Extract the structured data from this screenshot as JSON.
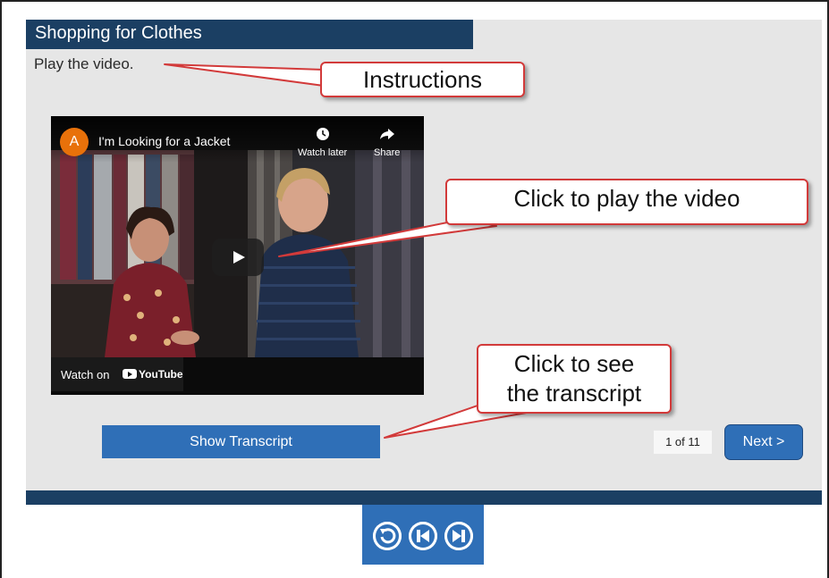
{
  "lesson": {
    "title": "Shopping for Clothes",
    "instruction": "Play the video."
  },
  "video": {
    "channel_initial": "A",
    "title": "I'm Looking for a Jacket",
    "watch_later_label": "Watch later",
    "share_label": "Share",
    "watch_on_label": "Watch on",
    "youtube_label": "YouTube"
  },
  "controls": {
    "show_transcript_label": "Show Transcript",
    "page_indicator": "1 of 11",
    "next_label": "Next >"
  },
  "callouts": {
    "instructions": "Instructions",
    "play_video": "Click to play the video",
    "see_transcript_line1": "Click to see",
    "see_transcript_line2": "the transcript"
  },
  "colors": {
    "navy": "#1b3f63",
    "button_blue": "#2f6fb7",
    "callout_border": "#d23a3a",
    "avatar_orange": "#e8710a"
  },
  "icons": [
    "replay-icon",
    "previous-icon",
    "next-track-icon",
    "play-icon",
    "clock-icon",
    "share-arrow-icon",
    "youtube-logo-icon"
  ]
}
